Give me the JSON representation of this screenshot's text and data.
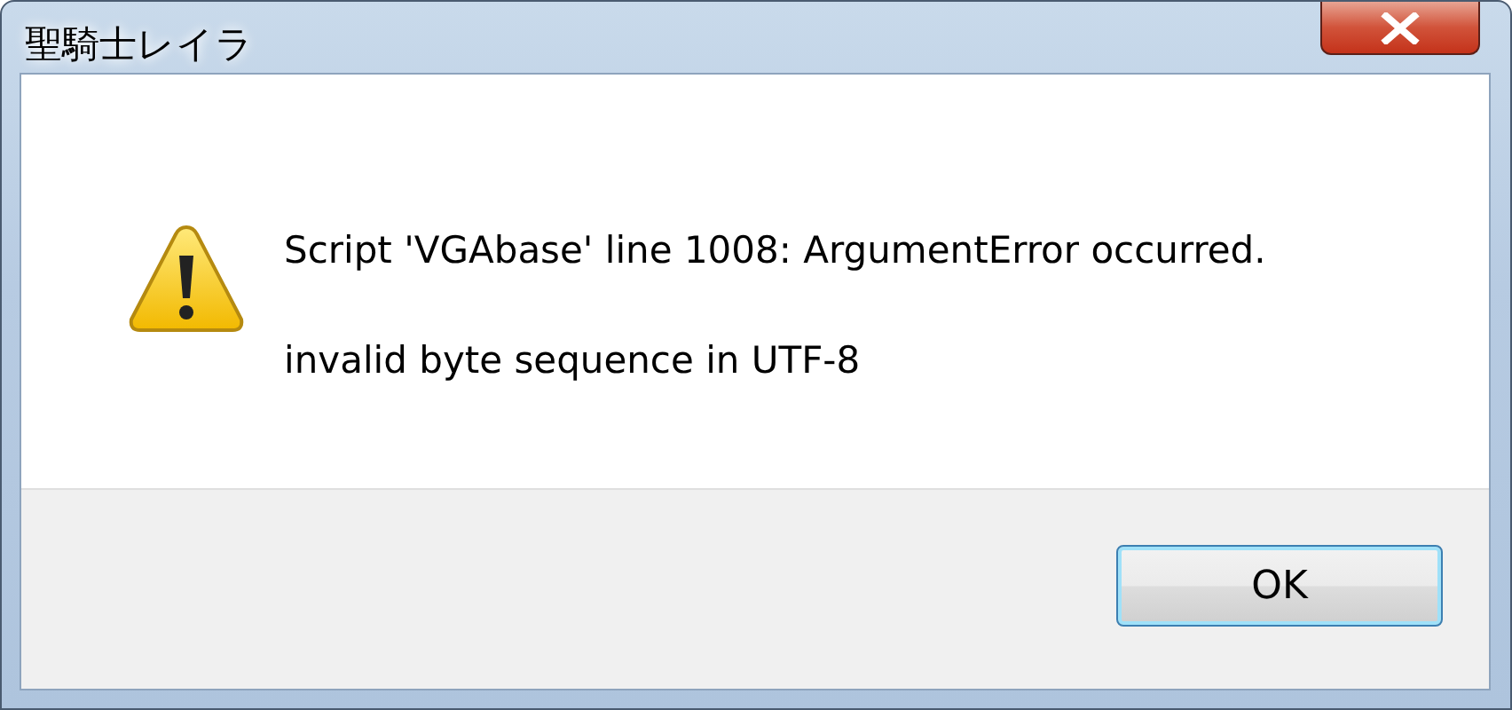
{
  "window": {
    "title": "聖騎士レイラ"
  },
  "message": {
    "lines": [
      "Script 'VGAbase' line 1008: ArgumentError occurred.",
      "invalid byte sequence in UTF-8"
    ]
  },
  "buttons": [
    {
      "label": "OK",
      "default": true
    }
  ]
}
